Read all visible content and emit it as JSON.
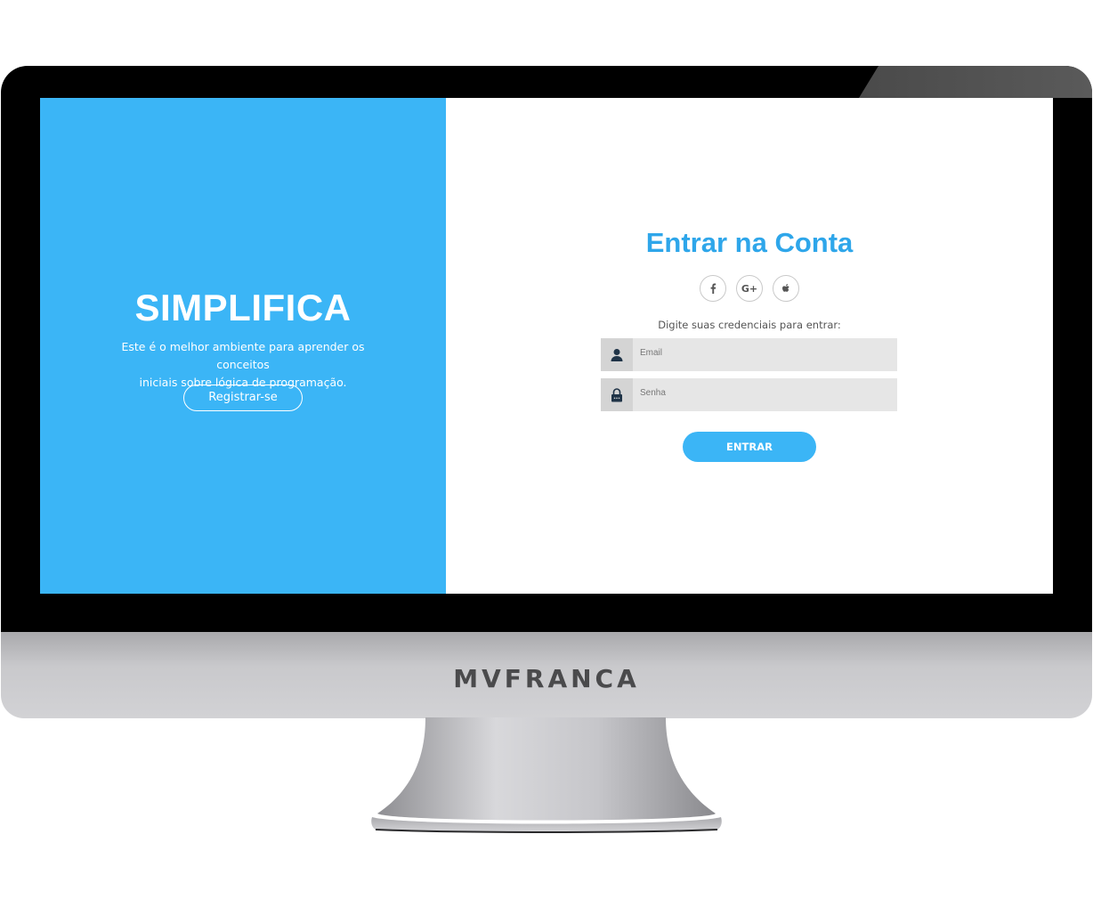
{
  "monitor": {
    "chin_brand": "MVFRANCA"
  },
  "left_panel": {
    "title": "SIMPLIFICA",
    "description_line1": "Este é o melhor ambiente para aprender os conceitos",
    "description_line2": "iniciais sobre lógica de programação.",
    "register_label": "Registrar-se",
    "background_color": "#3bb5f6"
  },
  "login": {
    "title": "Entrar na Conta",
    "social_icons": [
      "facebook-icon",
      "google-plus-icon",
      "apple-icon"
    ],
    "google_label": "G+",
    "instructions": "Digite suas credenciais para entrar:",
    "email_placeholder": "Email",
    "password_placeholder": "Senha",
    "submit_label": "ENTRAR",
    "accent_color": "#2ea6ea"
  }
}
